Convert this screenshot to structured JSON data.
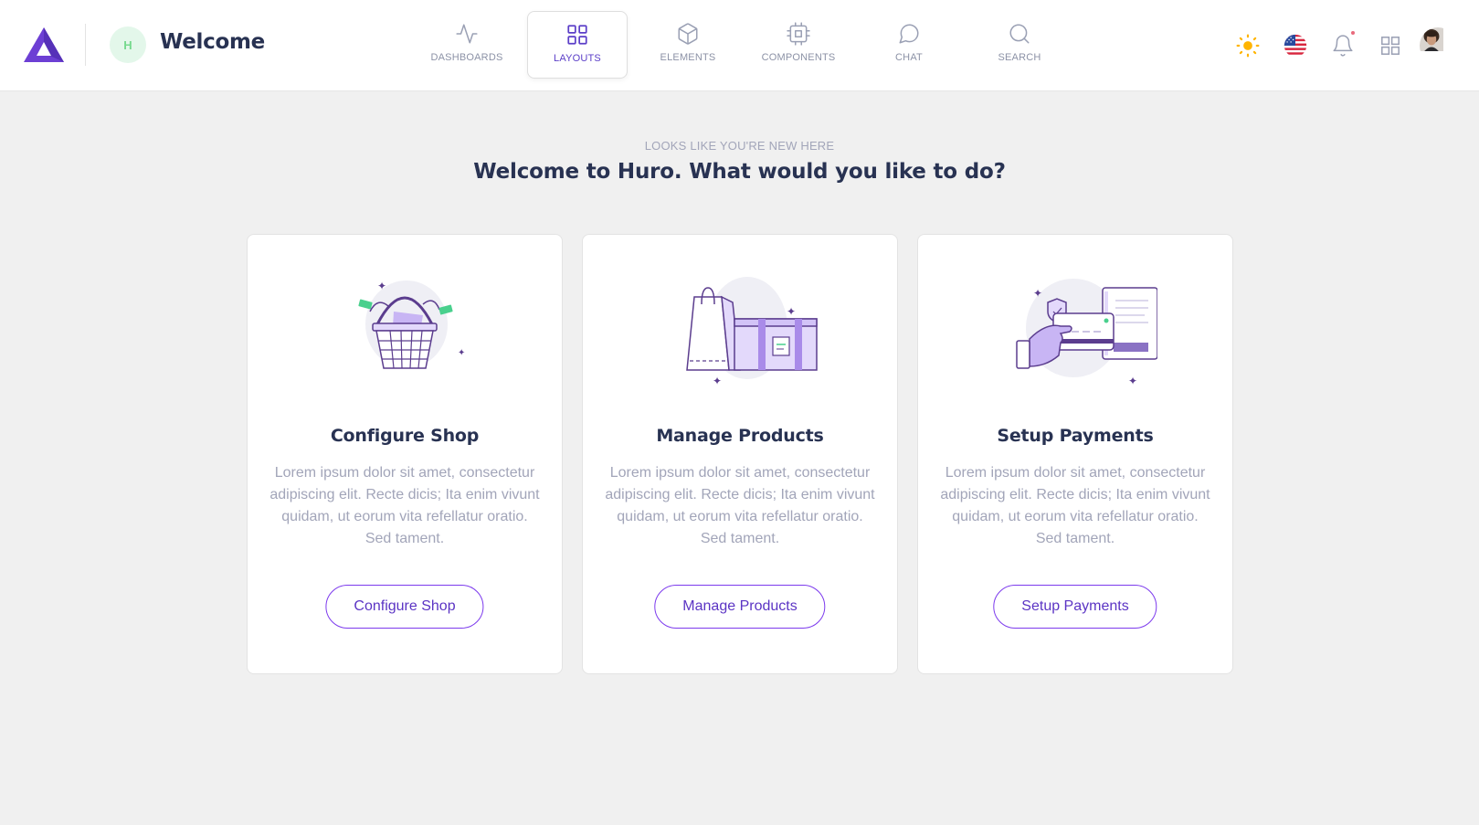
{
  "header": {
    "page_avatar_letter": "H",
    "page_title": "Welcome",
    "nav": [
      {
        "label": "DASHBOARDS",
        "icon": "activity-icon"
      },
      {
        "label": "LAYOUTS",
        "icon": "grid-icon",
        "active": true
      },
      {
        "label": "ELEMENTS",
        "icon": "box-icon"
      },
      {
        "label": "COMPONENTS",
        "icon": "cpu-icon"
      },
      {
        "label": "CHAT",
        "icon": "message-circle-icon"
      },
      {
        "label": "SEARCH",
        "icon": "search-icon"
      }
    ],
    "right_icons": [
      "sun-icon",
      "us-flag-icon",
      "bell-icon",
      "apps-grid-icon",
      "user-avatar"
    ]
  },
  "hero": {
    "subtitle": "LOOKS LIKE YOU'RE NEW HERE",
    "title": "Welcome to Huro. What would you like to do?"
  },
  "cards": [
    {
      "title": "Configure Shop",
      "text": "Lorem ipsum dolor sit amet, consectetur adipiscing elit. Recte dicis; Ita enim vivunt quidam, ut eorum vita refellatur oratio. Sed tament.",
      "button": "Configure Shop",
      "illustration": "basket-illustration"
    },
    {
      "title": "Manage Products",
      "text": "Lorem ipsum dolor sit amet, consectetur adipiscing elit. Recte dicis; Ita enim vivunt quidam, ut eorum vita refellatur oratio. Sed tament.",
      "button": "Manage Products",
      "illustration": "shopping-bag-box-illustration"
    },
    {
      "title": "Setup Payments",
      "text": "Lorem ipsum dolor sit amet, consectetur adipiscing elit. Recte dicis; Ita enim vivunt quidam, ut eorum vita refellatur oratio. Sed tament.",
      "button": "Setup Payments",
      "illustration": "card-payment-illustration"
    }
  ],
  "colors": {
    "brand": "#6d3fd4",
    "accent_text": "#5b34c4",
    "heading": "#283252",
    "muted": "#a2a5b9",
    "background": "#f0f0f0",
    "illustration_fill": "#e3d9fb",
    "illustration_stroke": "#5b3d8e"
  }
}
